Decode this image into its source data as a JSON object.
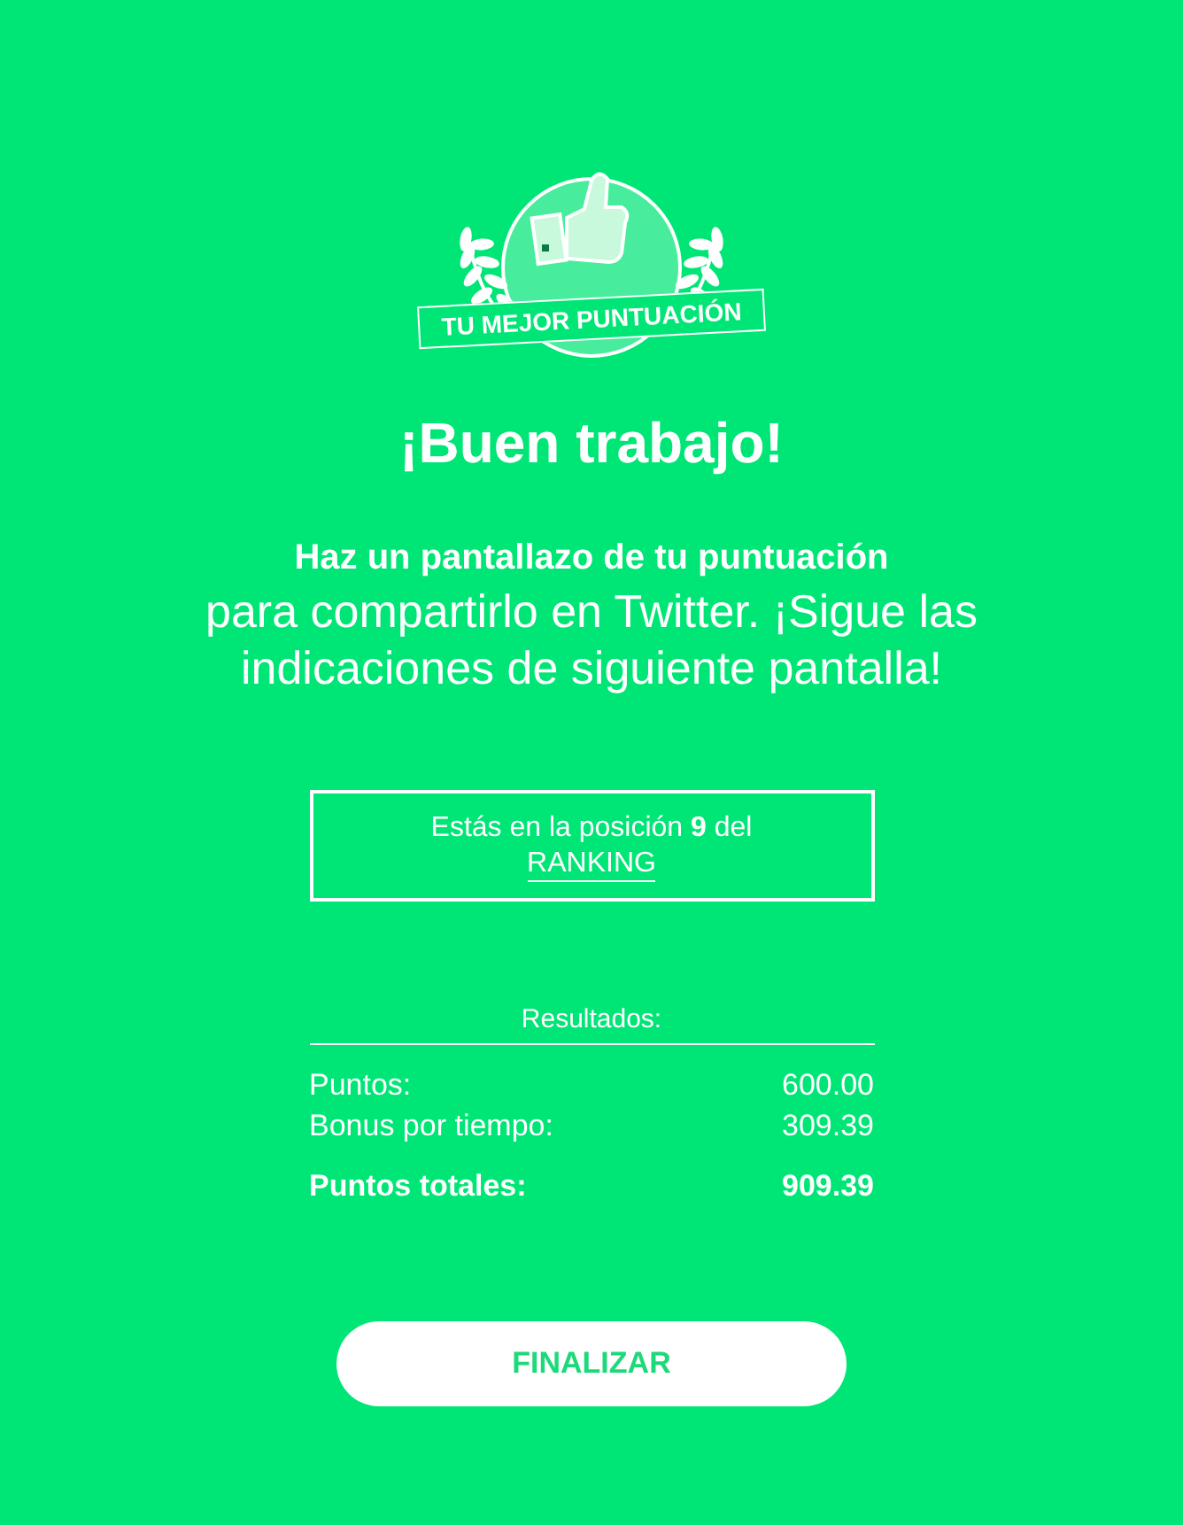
{
  "badge": {
    "label": "TU MEJOR PUNTUACIÓN"
  },
  "heading": "¡Buen trabajo!",
  "instruction": {
    "title": "Haz un pantallazo de tu puntuación",
    "text": "para compartirlo en Twitter. ¡Sigue las indicaciones de siguiente pantalla!"
  },
  "ranking": {
    "text": "Estás en la posición **9** del",
    "link": "RANKING"
  },
  "results": {
    "title": "Resultados:",
    "rows": [
      {
        "label": "Puntos:",
        "value": "600.00",
        "kind": "normal"
      },
      {
        "label": "Bonus por tiempo:",
        "value": "309.39",
        "kind": "normal"
      },
      {
        "label": "Puntos totales:",
        "value": "909.39",
        "kind": "total"
      }
    ]
  },
  "button": {
    "label": "FINALIZAR"
  }
}
